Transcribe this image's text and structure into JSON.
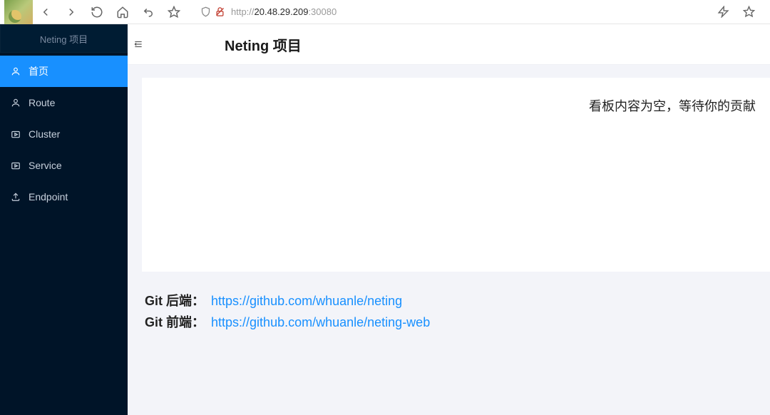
{
  "browser": {
    "url_proto": "http://",
    "url_host": "20.48.29.209",
    "url_port": ":30080"
  },
  "sidebar": {
    "header": "Neting 项目",
    "items": [
      {
        "label": "首页",
        "icon": "user-icon",
        "active": true
      },
      {
        "label": "Route",
        "icon": "user-icon",
        "active": false
      },
      {
        "label": "Cluster",
        "icon": "camera-icon",
        "active": false
      },
      {
        "label": "Service",
        "icon": "camera-icon",
        "active": false
      },
      {
        "label": "Endpoint",
        "icon": "upload-icon",
        "active": false
      }
    ]
  },
  "header": {
    "page_title": "Neting 项目"
  },
  "main": {
    "empty_banner": "看板内容为空，等待你的贡献"
  },
  "footer": {
    "backend_label": "Git 后端：",
    "backend_link": "https://github.com/whuanle/neting",
    "frontend_label": "Git 前端：",
    "frontend_link": "https://github.com/whuanle/neting-web"
  }
}
